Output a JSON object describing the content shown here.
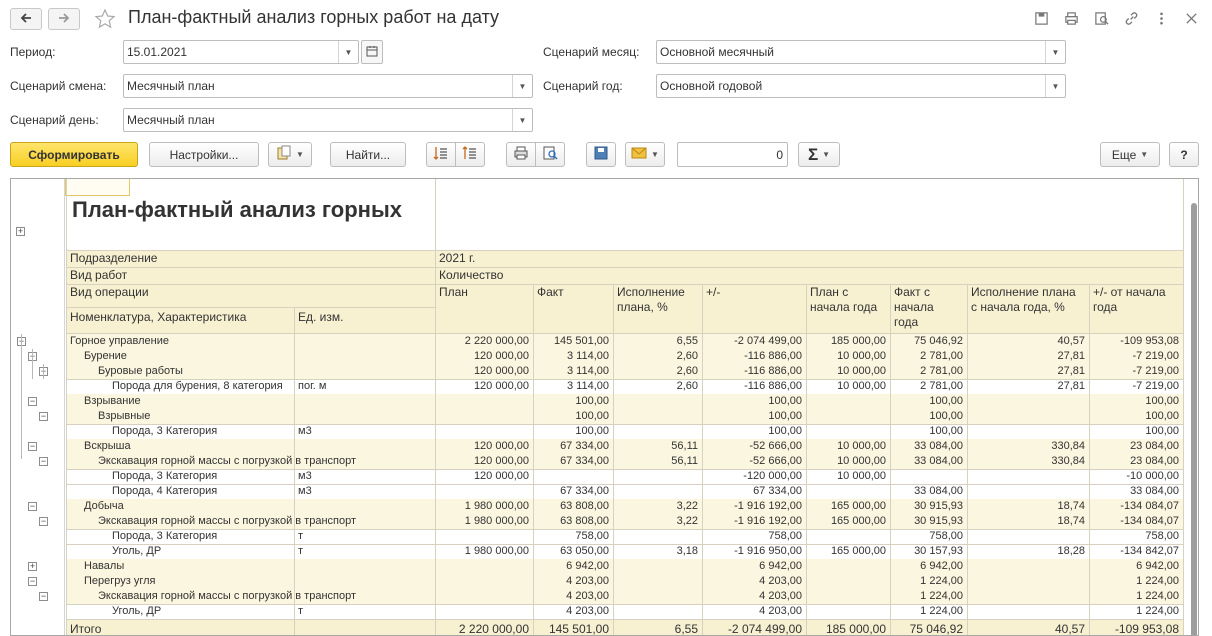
{
  "window": {
    "title": "План-фактный анализ горных работ на дату",
    "icons": [
      "back-arrow-icon",
      "forward-arrow-icon",
      "star-icon",
      "save-icon",
      "print-icon",
      "preview-icon",
      "link-icon",
      "more-vertical-icon",
      "close-icon"
    ]
  },
  "form": {
    "period_label": "Период:",
    "period_value": "15.01.2021",
    "shift_label": "Сценарий смена:",
    "shift_value": "Месячный план",
    "day_label": "Сценарий день:",
    "day_value": "Месячный план",
    "month_label": "Сценарий месяц:",
    "month_value": "Основной месячный",
    "year_label": "Сценарий год:",
    "year_value": "Основной годовой"
  },
  "toolbar": {
    "generate": "Сформировать",
    "settings": "Настройки...",
    "find": "Найти...",
    "sum_value": "0",
    "more": "Еще",
    "help": "?",
    "sigma": "Σ"
  },
  "colors": {
    "accent": "#f7cf23",
    "header_bg": "#f7f1d2",
    "group_bg": "#fbf6df",
    "border": "#d6d2bf"
  },
  "report": {
    "title": "План-фактный анализ горных",
    "headers": {
      "department": "Подразделение",
      "work_type": "Вид работ",
      "operation": "Вид операции",
      "nomenclature": "Номенклатура, Характеристика",
      "unit": "Ед. изм.",
      "year": "2021 г.",
      "quantity": "Количество",
      "plan": "План",
      "fact": "Факт",
      "exec": "Исполнение\nплана, %",
      "diff": "+/-",
      "plan_ytd": "План с\nначала года",
      "fact_ytd": "Факт с\nначала\nгода",
      "exec_ytd": "Исполнение плана\nс начала года, %",
      "diff_ytd": "+/- от начала\nгода"
    },
    "rows": [
      {
        "level": 0,
        "name": "Горное управление",
        "unit": "",
        "plan": "2 220 000,00",
        "fact": "145 501,00",
        "exec": "6,55",
        "diff": "-2 074 499,00",
        "plan_ytd": "185 000,00",
        "fact_ytd": "75 046,92",
        "exec_ytd": "40,57",
        "diff_ytd": "-109 953,08"
      },
      {
        "level": 1,
        "name": "Бурение",
        "unit": "",
        "plan": "120 000,00",
        "fact": "3 114,00",
        "exec": "2,60",
        "diff": "-116 886,00",
        "plan_ytd": "10 000,00",
        "fact_ytd": "2 781,00",
        "exec_ytd": "27,81",
        "diff_ytd": "-7 219,00"
      },
      {
        "level": 2,
        "name": "Буровые работы",
        "unit": "",
        "plan": "120 000,00",
        "fact": "3 114,00",
        "exec": "2,60",
        "diff": "-116 886,00",
        "plan_ytd": "10 000,00",
        "fact_ytd": "2 781,00",
        "exec_ytd": "27,81",
        "diff_ytd": "-7 219,00"
      },
      {
        "level": 3,
        "name": "Порода для бурения, 8 категория",
        "unit": "пог. м",
        "plan": "120 000,00",
        "fact": "3 114,00",
        "exec": "2,60",
        "diff": "-116 886,00",
        "plan_ytd": "10 000,00",
        "fact_ytd": "2 781,00",
        "exec_ytd": "27,81",
        "diff_ytd": "-7 219,00"
      },
      {
        "level": 1,
        "name": "Взрывание",
        "unit": "",
        "plan": "",
        "fact": "100,00",
        "exec": "",
        "diff": "100,00",
        "plan_ytd": "",
        "fact_ytd": "100,00",
        "exec_ytd": "",
        "diff_ytd": "100,00"
      },
      {
        "level": 2,
        "name": "Взрывные",
        "unit": "",
        "plan": "",
        "fact": "100,00",
        "exec": "",
        "diff": "100,00",
        "plan_ytd": "",
        "fact_ytd": "100,00",
        "exec_ytd": "",
        "diff_ytd": "100,00"
      },
      {
        "level": 3,
        "name": "Порода, 3 Категория",
        "unit": "м3",
        "plan": "",
        "fact": "100,00",
        "exec": "",
        "diff": "100,00",
        "plan_ytd": "",
        "fact_ytd": "100,00",
        "exec_ytd": "",
        "diff_ytd": "100,00"
      },
      {
        "level": 1,
        "name": "Вскрыша",
        "unit": "",
        "plan": "120 000,00",
        "fact": "67 334,00",
        "exec": "56,11",
        "diff": "-52 666,00",
        "plan_ytd": "10 000,00",
        "fact_ytd": "33 084,00",
        "exec_ytd": "330,84",
        "diff_ytd": "23 084,00"
      },
      {
        "level": 2,
        "name": "Экскавация горной массы с погрузкой в транспорт",
        "unit": "",
        "plan": "120 000,00",
        "fact": "67 334,00",
        "exec": "56,11",
        "diff": "-52 666,00",
        "plan_ytd": "10 000,00",
        "fact_ytd": "33 084,00",
        "exec_ytd": "330,84",
        "diff_ytd": "23 084,00"
      },
      {
        "level": 3,
        "name": "Порода, 3 Категория",
        "unit": "м3",
        "plan": "120 000,00",
        "fact": "",
        "exec": "",
        "diff": "-120 000,00",
        "plan_ytd": "10 000,00",
        "fact_ytd": "",
        "exec_ytd": "",
        "diff_ytd": "-10 000,00"
      },
      {
        "level": 3,
        "name": "Порода, 4 Категория",
        "unit": "м3",
        "plan": "",
        "fact": "67 334,00",
        "exec": "",
        "diff": "67 334,00",
        "plan_ytd": "",
        "fact_ytd": "33 084,00",
        "exec_ytd": "",
        "diff_ytd": "33 084,00"
      },
      {
        "level": 1,
        "name": "Добыча",
        "unit": "",
        "plan": "1 980 000,00",
        "fact": "63 808,00",
        "exec": "3,22",
        "diff": "-1 916 192,00",
        "plan_ytd": "165 000,00",
        "fact_ytd": "30 915,93",
        "exec_ytd": "18,74",
        "diff_ytd": "-134 084,07"
      },
      {
        "level": 2,
        "name": "Экскавация горной массы с погрузкой в транспорт",
        "unit": "",
        "plan": "1 980 000,00",
        "fact": "63 808,00",
        "exec": "3,22",
        "diff": "-1 916 192,00",
        "plan_ytd": "165 000,00",
        "fact_ytd": "30 915,93",
        "exec_ytd": "18,74",
        "diff_ytd": "-134 084,07"
      },
      {
        "level": 3,
        "name": "Порода, 3 Категория",
        "unit": "т",
        "plan": "",
        "fact": "758,00",
        "exec": "",
        "diff": "758,00",
        "plan_ytd": "",
        "fact_ytd": "758,00",
        "exec_ytd": "",
        "diff_ytd": "758,00"
      },
      {
        "level": 3,
        "name": "Уголь, ДР",
        "unit": "т",
        "plan": "1 980 000,00",
        "fact": "63 050,00",
        "exec": "3,18",
        "diff": "-1 916 950,00",
        "plan_ytd": "165 000,00",
        "fact_ytd": "30 157,93",
        "exec_ytd": "18,28",
        "diff_ytd": "-134 842,07"
      },
      {
        "level": 1,
        "name": "Навалы",
        "unit": "",
        "plan": "",
        "fact": "6 942,00",
        "exec": "",
        "diff": "6 942,00",
        "plan_ytd": "",
        "fact_ytd": "6 942,00",
        "exec_ytd": "",
        "diff_ytd": "6 942,00",
        "collapsed": true
      },
      {
        "level": 1,
        "name": "Перегруз угля",
        "unit": "",
        "plan": "",
        "fact": "4 203,00",
        "exec": "",
        "diff": "4 203,00",
        "plan_ytd": "",
        "fact_ytd": "1 224,00",
        "exec_ytd": "",
        "diff_ytd": "1 224,00"
      },
      {
        "level": 2,
        "name": "Экскавация горной массы с погрузкой в транспорт",
        "unit": "",
        "plan": "",
        "fact": "4 203,00",
        "exec": "",
        "diff": "4 203,00",
        "plan_ytd": "",
        "fact_ytd": "1 224,00",
        "exec_ytd": "",
        "diff_ytd": "1 224,00"
      },
      {
        "level": 3,
        "name": "Уголь, ДР",
        "unit": "т",
        "plan": "",
        "fact": "4 203,00",
        "exec": "",
        "diff": "4 203,00",
        "plan_ytd": "",
        "fact_ytd": "1 224,00",
        "exec_ytd": "",
        "diff_ytd": "1 224,00"
      }
    ],
    "total": {
      "name": "Итого",
      "plan": "2 220 000,00",
      "fact": "145 501,00",
      "exec": "6,55",
      "diff": "-2 074 499,00",
      "plan_ytd": "185 000,00",
      "fact_ytd": "75 046,92",
      "exec_ytd": "40,57",
      "diff_ytd": "-109 953,08"
    }
  }
}
